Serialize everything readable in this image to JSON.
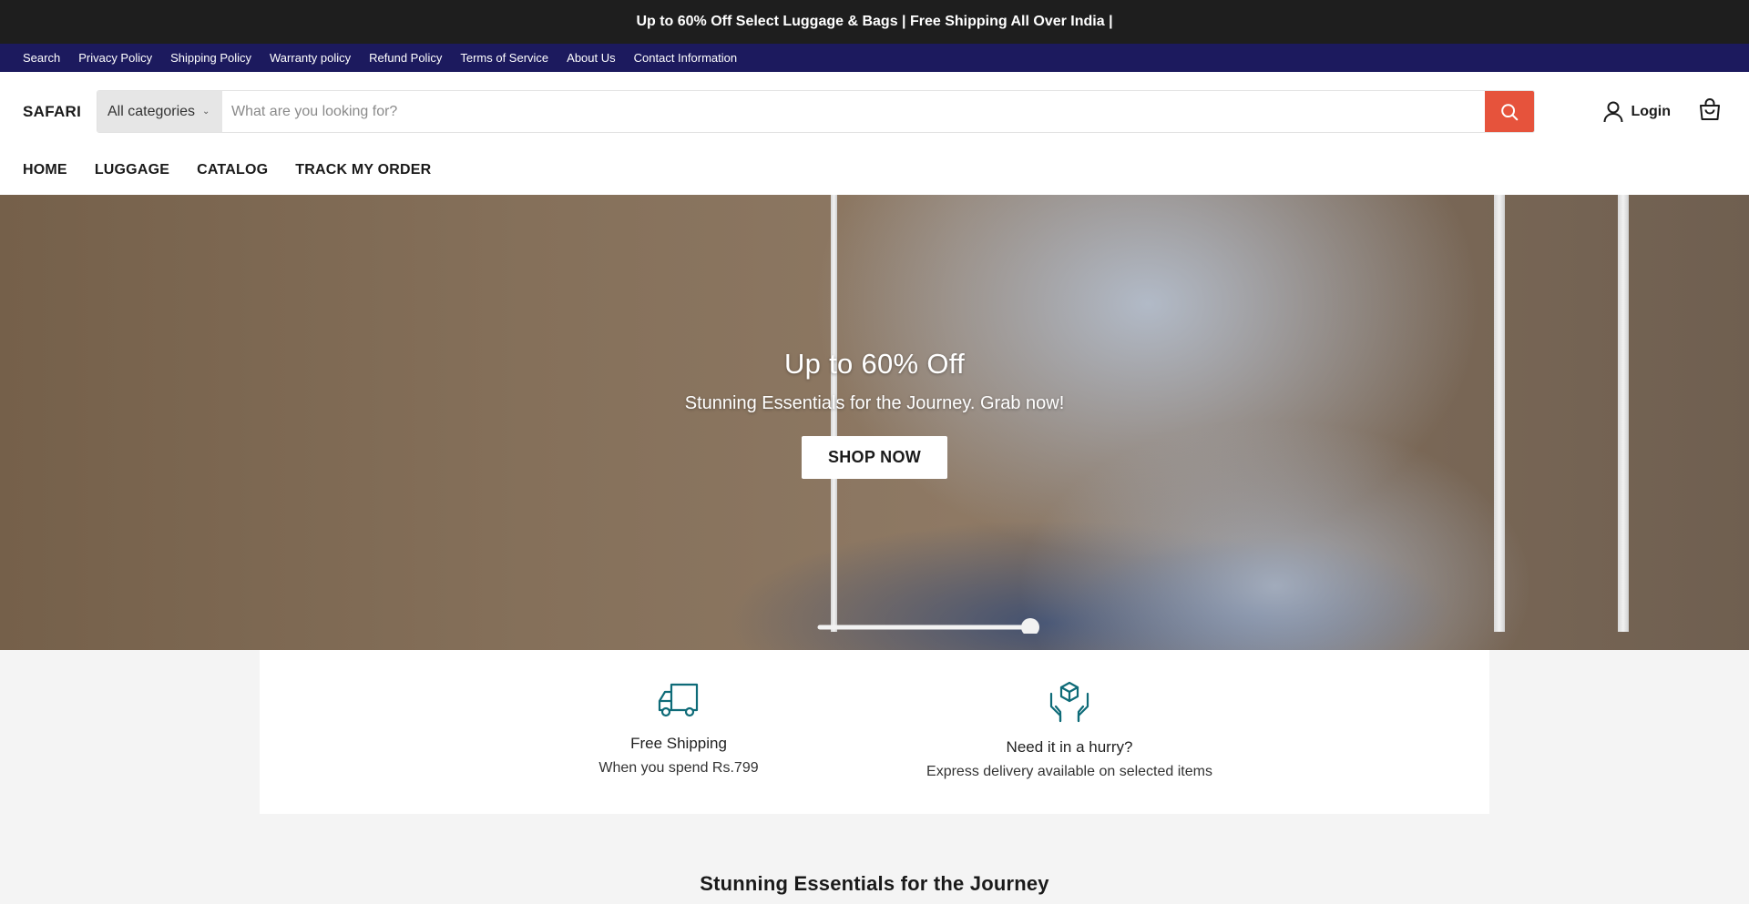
{
  "announcement": {
    "text": "Up to 60% Off Select Luggage & Bags | Free Shipping All Over India |"
  },
  "policy_links": [
    {
      "label": "Search"
    },
    {
      "label": "Privacy Policy"
    },
    {
      "label": "Shipping Policy"
    },
    {
      "label": "Warranty policy"
    },
    {
      "label": "Refund Policy"
    },
    {
      "label": "Terms of Service"
    },
    {
      "label": "About Us"
    },
    {
      "label": "Contact Information"
    }
  ],
  "header": {
    "logo": "SAFARI",
    "category_select": "All categories",
    "search_placeholder": "What are you looking for?",
    "login_label": "Login"
  },
  "nav": [
    {
      "label": "HOME"
    },
    {
      "label": "LUGGAGE"
    },
    {
      "label": "CATALOG"
    },
    {
      "label": "TRACK MY ORDER"
    }
  ],
  "hero": {
    "title": "Up to 60% Off",
    "subtitle": "Stunning Essentials for the Journey. Grab now!",
    "cta": "SHOP NOW"
  },
  "features": [
    {
      "icon": "truck-icon",
      "title": "Free Shipping",
      "subtitle": "When you spend Rs.799"
    },
    {
      "icon": "hands-box-icon",
      "title": "Need it in a hurry?",
      "subtitle": "Express delivery available on selected items"
    }
  ],
  "section": {
    "title": "Stunning Essentials for the Journey"
  },
  "colors": {
    "announcement_bg": "#1e1e1e",
    "policy_bar_bg": "#1c1a5e",
    "search_button": "#e6533c",
    "feature_icon": "#0e6b78"
  }
}
